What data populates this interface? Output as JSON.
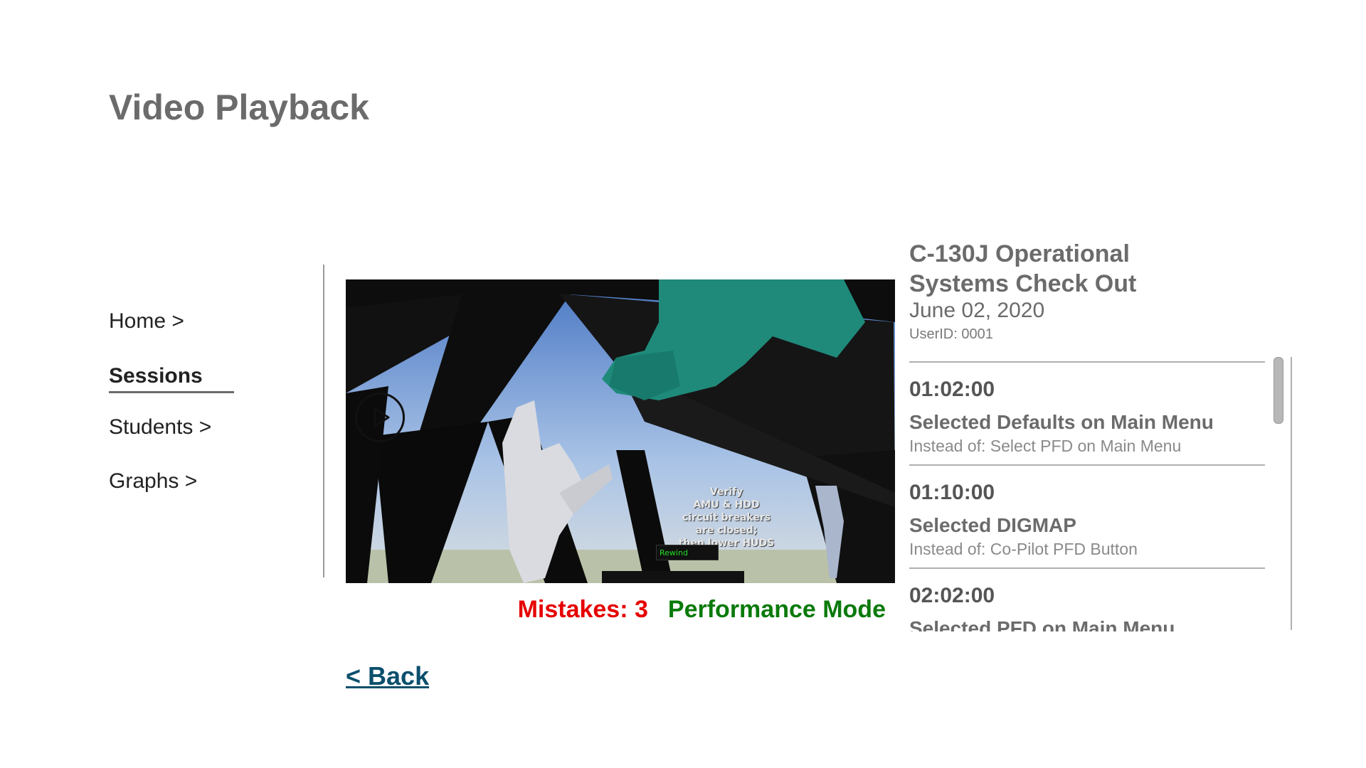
{
  "page": {
    "title": "Video Playback"
  },
  "nav": {
    "items": [
      {
        "label": "Home >",
        "active": false
      },
      {
        "label": "Sessions",
        "active": true
      },
      {
        "label": "Students >",
        "active": false
      },
      {
        "label": "Graphs >",
        "active": false
      }
    ]
  },
  "video": {
    "hud_text_lines": [
      "Verify",
      "AMU & HDD",
      "circuit breakers",
      "are closed;",
      "then lower HUDS"
    ],
    "hud_button": "Rewind"
  },
  "status": {
    "mistakes": "Mistakes: 3",
    "mode": "Performance Mode",
    "mistakes_color": "#e60000",
    "mode_color": "#0a7a0a"
  },
  "back_link": "< Back",
  "session": {
    "title": "C-130J Operational Systems Check Out",
    "date": "June 02, 2020",
    "user": "UserID: 0001"
  },
  "events": [
    {
      "time": "01:02:00",
      "action": "Selected Defaults on Main Menu",
      "instead": "Instead of: Select PFD on Main Menu"
    },
    {
      "time": "01:10:00",
      "action": "Selected DIGMAP",
      "instead": "Instead of: Co-Pilot PFD Button"
    },
    {
      "time": "02:02:00",
      "action": "Selected PFD on Main Menu",
      "instead": ""
    }
  ]
}
